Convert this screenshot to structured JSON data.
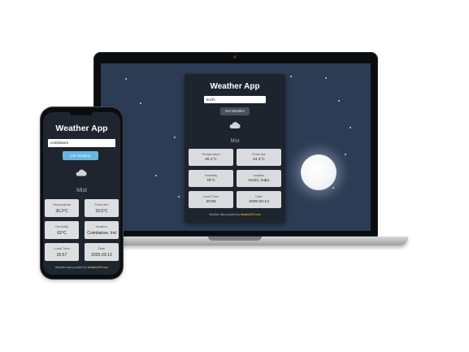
{
  "laptop": {
    "app": {
      "title": "Weather App",
      "search": {
        "value": "kochi"
      },
      "button_label": "Get Weather",
      "weather_icon": "cloud-icon",
      "condition": "Mist",
      "tiles": [
        {
          "label": "Temperature",
          "value": "25.1°C"
        },
        {
          "label": "Feels like",
          "value": "24.3°C"
        },
        {
          "label": "Humidity",
          "value": "78°C"
        },
        {
          "label": "location",
          "value": "Kochi, India"
        },
        {
          "label": "Local Time",
          "value": "20:56"
        },
        {
          "label": "Date",
          "value": "2025-03-13"
        }
      ],
      "footer": {
        "text": "Weather data provided by",
        "brand": "WeatherAPI.com"
      }
    }
  },
  "phone": {
    "app": {
      "title": "Weather App",
      "search": {
        "value": "coimbatore"
      },
      "button_label": "Get Weather",
      "weather_icon": "cloud-icon",
      "condition": "Mist",
      "tiles": [
        {
          "label": "Temperature",
          "value": "30.2°C"
        },
        {
          "label": "Feels like",
          "value": "33.5°C"
        },
        {
          "label": "Humidity",
          "value": "63°C"
        },
        {
          "label": "location",
          "value": "Coimbatore, Ind"
        },
        {
          "label": "Local Time",
          "value": "20:57"
        },
        {
          "label": "Date",
          "value": "2025-03-13"
        }
      ],
      "footer": {
        "text": "Weather data provided by",
        "brand": "WeatherAPI.com"
      }
    }
  },
  "colors": {
    "laptop_background": "#2b3c54",
    "card": "#1d242d",
    "tile": "#d9dbde",
    "phone_button": "#66b6e3",
    "brand_link": "#e8d54a"
  }
}
